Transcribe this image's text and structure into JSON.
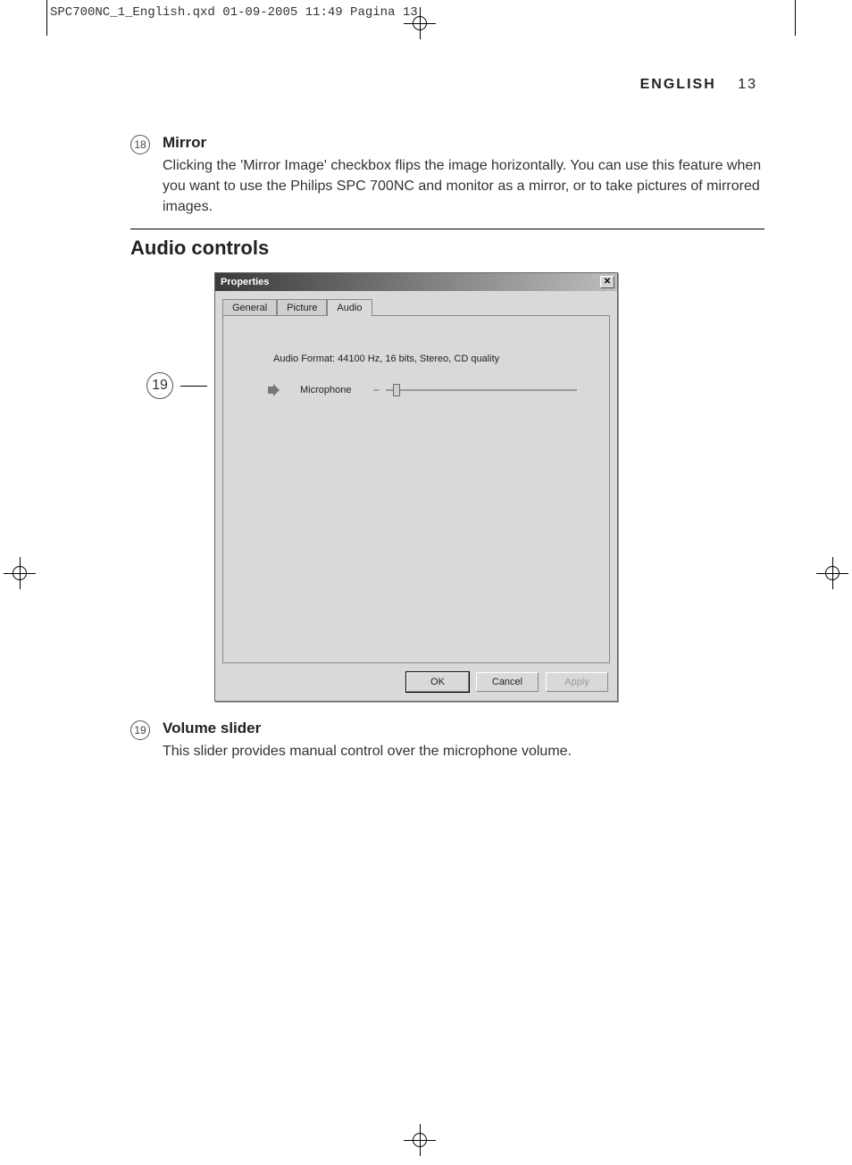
{
  "header_file": "SPC700NC_1_English.qxd  01-09-2005  11:49  Pagina 13",
  "page_header": {
    "lang": "ENGLISH",
    "num": "13"
  },
  "item18": {
    "marker": "18",
    "title": "Mirror",
    "desc": "Clicking the 'Mirror Image' checkbox flips the image horizontally. You can use this feature when you want to use the Philips SPC 700NC and monitor as a mirror, or to take pictures of mirrored images."
  },
  "section_title": "Audio controls",
  "callout19": "19",
  "dialog": {
    "title": "Properties",
    "tabs": {
      "general": "General",
      "picture": "Picture",
      "audio": "Audio"
    },
    "audio_format": "Audio Format: 44100 Hz, 16 bits, Stereo, CD quality",
    "mic_label": "Microphone",
    "buttons": {
      "ok": "OK",
      "cancel": "Cancel",
      "apply": "Apply"
    }
  },
  "item19": {
    "marker": "19",
    "title": "Volume slider",
    "desc": "This slider provides manual control over the microphone volume."
  }
}
